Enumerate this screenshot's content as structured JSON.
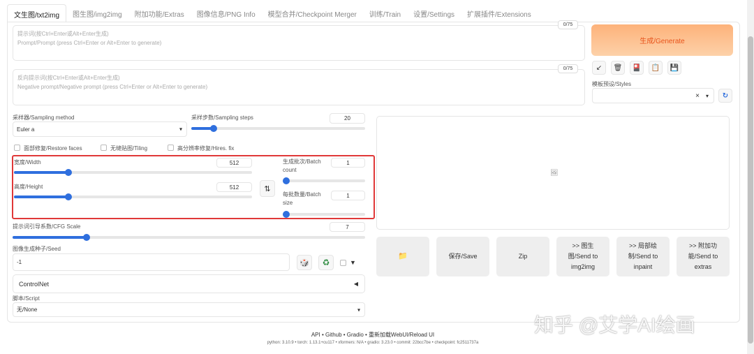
{
  "tabs": [
    "文生图/txt2img",
    "图生图/img2img",
    "附加功能/Extras",
    "图像信息/PNG Info",
    "模型合并/Checkpoint Merger",
    "训练/Train",
    "设置/Settings",
    "扩展插件/Extensions"
  ],
  "prompt": {
    "placeholder_line1": "提示词(按Ctrl+Enter或Alt+Enter生成)",
    "placeholder_line2": "Prompt/Prompt (press Ctrl+Enter or Alt+Enter to generate)",
    "counter": "0/75"
  },
  "negative_prompt": {
    "placeholder_line1": "反向提示词(按Ctrl+Enter或Alt+Enter生成)",
    "placeholder_line2": "Negative prompt/Negative prompt (press Ctrl+Enter or Alt+Enter to generate)",
    "counter": "0/75"
  },
  "generate_label": "生成/Generate",
  "tools": {
    "arrow_icon": "↙",
    "trash_icon": "🗑",
    "card_icon": "🎴",
    "clipboard_icon": "📋",
    "save_icon": "💾"
  },
  "styles": {
    "label": "模板预设/Styles",
    "clear": "×",
    "caret": "▾",
    "refresh_icon": "↻"
  },
  "sampling": {
    "method_label": "采样器/Sampling method",
    "method_value": "Euler a",
    "steps_label": "采样步数/Sampling steps",
    "steps_value": "20",
    "steps_fraction": 0.13
  },
  "checkboxes": {
    "restore_faces": "面部修复/Restore faces",
    "tiling": "无缝贴图/Tiling",
    "hires_fix": "高分辨率修复/Hires. fix"
  },
  "size": {
    "width_label": "宽度/Width",
    "width_value": "512",
    "width_fraction": 0.23,
    "height_label": "高度/Height",
    "height_value": "512",
    "height_fraction": 0.23,
    "swap_icon": "⇅"
  },
  "batch": {
    "count_label_1": "生成批次/Batch",
    "count_label_2": "count",
    "count_value": "1",
    "count_fraction": 0.0,
    "size_label_1": "每批数量/Batch",
    "size_label_2": "size",
    "size_value": "1",
    "size_fraction": 0.0
  },
  "cfg": {
    "label": "提示词引导系数/CFG Scale",
    "value": "7",
    "fraction": 0.21
  },
  "seed": {
    "label": "图像生成种子/Seed",
    "value": "-1",
    "dice_icon": "🎲",
    "recycle_icon": "♻",
    "extra_caret": "▼"
  },
  "controlnet": {
    "label": "ControlNet",
    "toggle": "◀"
  },
  "script": {
    "label": "脚本/Script",
    "value": "无/None",
    "caret": "▾"
  },
  "output": {
    "image_icon": "🖼"
  },
  "output_buttons": {
    "folder_icon": "📁",
    "save": "保存/Save",
    "zip": "Zip",
    "img2img_1": ">> 图生",
    "img2img_2": "图/Send to",
    "img2img_3": "img2img",
    "inpaint_1": ">> 局部绘",
    "inpaint_2": "制/Send to",
    "inpaint_3": "inpaint",
    "extras_1": ">> 附加功",
    "extras_2": "能/Send to",
    "extras_3": "extras"
  },
  "footer": {
    "links": "API • Github • Gradio • 重新加载WebUI/Reload UI",
    "info": "python: 3.10.9  •  torch: 1.13.1+cu117  •  xformers: N/A  •  gradio: 3.23.0  •  commit: 22bcc7be  •  checkpoint: fc2511737a"
  },
  "watermark": "知乎 @艾学AI绘画",
  "colors": {
    "accent": "#2f6fde",
    "generate_text": "#e8541c",
    "highlight_box": "#e03838"
  }
}
